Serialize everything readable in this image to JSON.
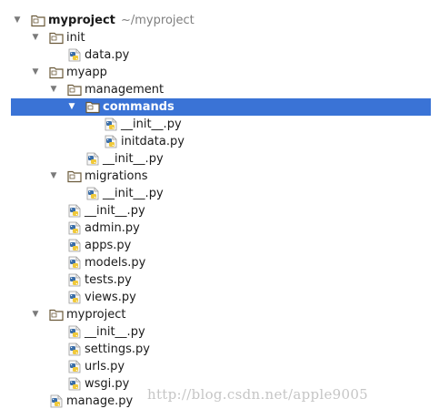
{
  "colors": {
    "selection": "#3a73d6",
    "folder_outline": "#6b5a3a",
    "python_blue": "#3b6ea8",
    "python_yellow": "#f0c93a",
    "muted_text": "#7f7f7f"
  },
  "tree": [
    {
      "name": "myproject",
      "kind": "folder",
      "depth": 0,
      "expanded": true,
      "bold": true,
      "note": "~/myproject"
    },
    {
      "name": "init",
      "kind": "folder",
      "depth": 1,
      "expanded": true
    },
    {
      "name": "data.py",
      "kind": "python-file",
      "depth": 2
    },
    {
      "name": "myapp",
      "kind": "folder",
      "depth": 1,
      "expanded": true
    },
    {
      "name": "management",
      "kind": "folder",
      "depth": 2,
      "expanded": true
    },
    {
      "name": "commands",
      "kind": "folder",
      "depth": 3,
      "expanded": true,
      "selected": true
    },
    {
      "name": "__init__.py",
      "kind": "python-file",
      "depth": 4
    },
    {
      "name": "initdata.py",
      "kind": "python-file",
      "depth": 4
    },
    {
      "name": "__init__.py",
      "kind": "python-file",
      "depth": 3
    },
    {
      "name": "migrations",
      "kind": "folder",
      "depth": 2,
      "expanded": true
    },
    {
      "name": "__init__.py",
      "kind": "python-file",
      "depth": 3
    },
    {
      "name": "__init__.py",
      "kind": "python-file",
      "depth": 2
    },
    {
      "name": "admin.py",
      "kind": "python-file",
      "depth": 2
    },
    {
      "name": "apps.py",
      "kind": "python-file",
      "depth": 2
    },
    {
      "name": "models.py",
      "kind": "python-file",
      "depth": 2
    },
    {
      "name": "tests.py",
      "kind": "python-file",
      "depth": 2
    },
    {
      "name": "views.py",
      "kind": "python-file",
      "depth": 2
    },
    {
      "name": "myproject",
      "kind": "folder",
      "depth": 1,
      "expanded": true
    },
    {
      "name": "__init__.py",
      "kind": "python-file",
      "depth": 2
    },
    {
      "name": "settings.py",
      "kind": "python-file",
      "depth": 2
    },
    {
      "name": "urls.py",
      "kind": "python-file",
      "depth": 2
    },
    {
      "name": "wsgi.py",
      "kind": "python-file",
      "depth": 2
    },
    {
      "name": "manage.py",
      "kind": "python-file",
      "depth": 1
    }
  ],
  "watermark": "http://blog.csdn.net/apple9005"
}
